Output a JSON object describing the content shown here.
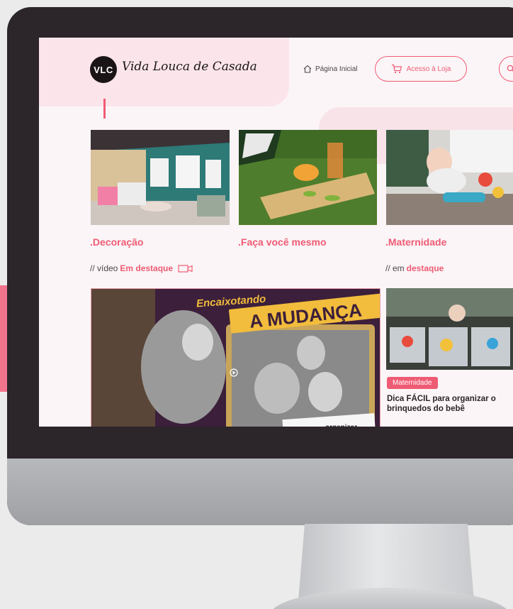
{
  "brand": {
    "logo_abbr": "VLC",
    "name": "Vida Louca de Casada"
  },
  "nav": {
    "home_label": "Página Inicial",
    "store_label": "Acesso à Loja"
  },
  "categories": [
    {
      "label": ".Decoração"
    },
    {
      "label": ".Faça você mesmo"
    },
    {
      "label": ".Maternidade"
    }
  ],
  "featured_video": {
    "prefix": "// vídeo",
    "highlight": "Em destaque",
    "banner_top": "Encaixotando",
    "banner_main": "A MUDANÇA",
    "banner_bottom": "organizar"
  },
  "featured_post": {
    "prefix": "// em",
    "highlight": "destaque",
    "badge": "Maternidade",
    "title": "Dica FÁCIL para organizar o brinquedos do bebê"
  },
  "colors": {
    "accent": "#ef5b74",
    "pink_bg": "#fbe5ea",
    "bezel": "#2c252a"
  },
  "icons": [
    "home-icon",
    "cart-icon",
    "search-icon",
    "video-camera-icon"
  ]
}
